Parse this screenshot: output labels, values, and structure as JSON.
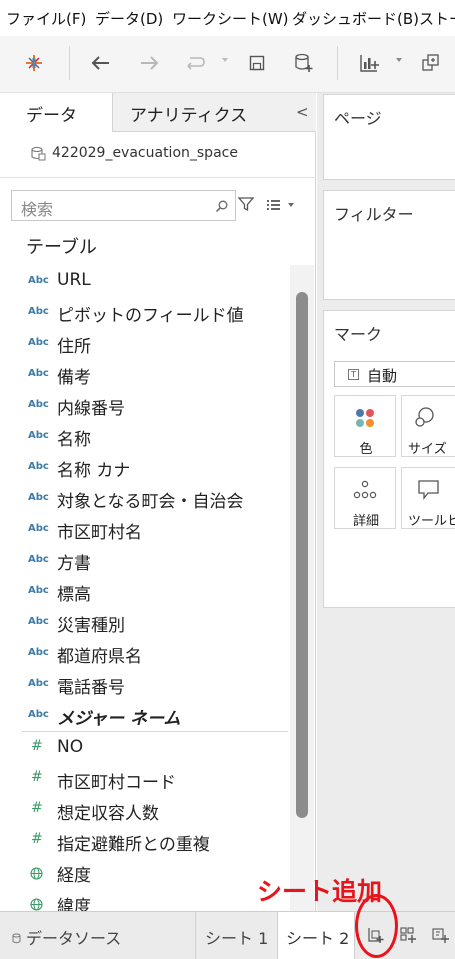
{
  "menu": {
    "items": [
      "ファイル(F)",
      "データ(D)",
      "ワークシート(W)",
      "ダッシュボード(B)",
      "ストー"
    ]
  },
  "toolbar": {
    "icons": [
      "tableau-logo-icon",
      "back-arrow-icon",
      "forward-arrow-icon",
      "redo-icon",
      "save-icon",
      "new-datasource-icon",
      "new-worksheet-icon",
      "duplicate-sheet-icon"
    ]
  },
  "data_pane": {
    "tab_data": "データ",
    "tab_analytics": "アナリティクス",
    "collapse_glyph": "<",
    "datasource_name": "422029_evacuation_space",
    "search_placeholder": "検索",
    "tables_header": "テーブル",
    "type_abc": "Abc",
    "type_num": "#",
    "dimension_fields": [
      "URL",
      "ピボットのフィールド値",
      "住所",
      "備考",
      "内線番号",
      "名称",
      "名称 カナ",
      "対象となる町会・自治会",
      "市区町村名",
      "方書",
      "標高",
      "災害種別",
      "都道府県名",
      "電話番号",
      "メジャー ネーム"
    ],
    "measure_fields": [
      "NO",
      "市区町村コード",
      "想定収容人数",
      "指定避難所との重複"
    ],
    "geo_fields": [
      "経度",
      "緯度"
    ]
  },
  "right_pane": {
    "pages_title": "ページ",
    "filters_title": "フィルター",
    "marks_title": "マーク",
    "mark_type": "自動",
    "mark_buttons": {
      "color": "色",
      "size": "サイズ",
      "detail": "詳細",
      "tooltip": "ツールヒント"
    }
  },
  "bottom_tabs": {
    "datasource": "データソース",
    "sheet1": "シート 1",
    "sheet2": "シート 2"
  },
  "annotation": {
    "text": "シート追加"
  },
  "colors": {
    "accent_red": "#e8141c",
    "abc_blue": "#3c7aa7",
    "measure_green": "#3c9a6a"
  }
}
